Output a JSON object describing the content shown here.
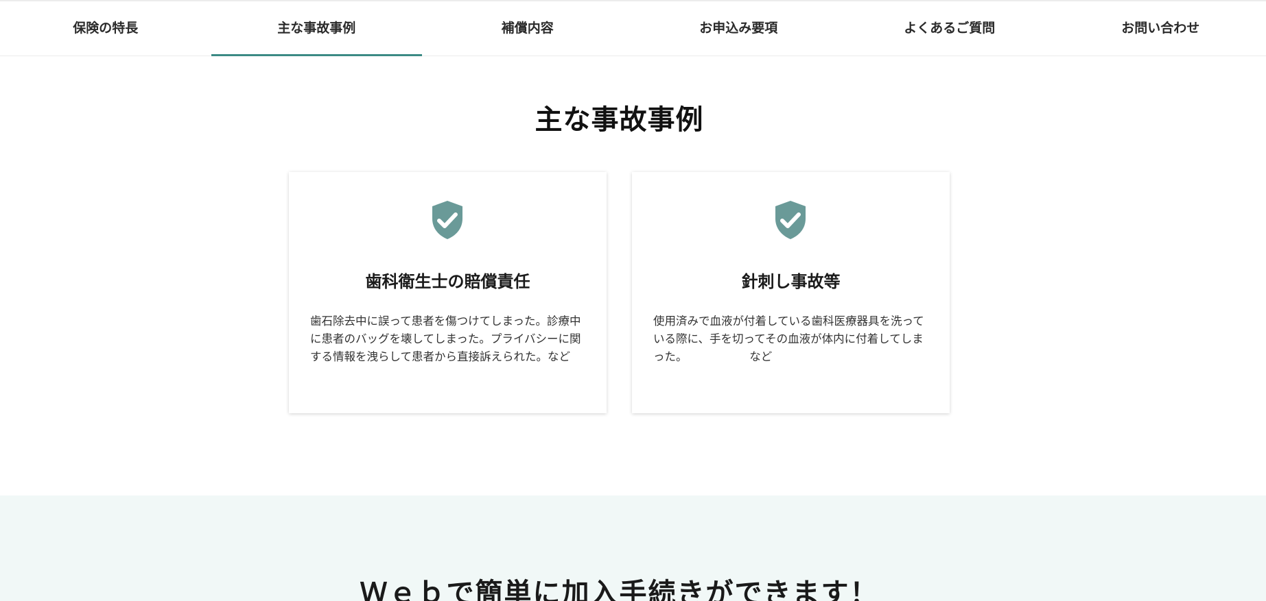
{
  "nav": {
    "items": [
      {
        "label": "保険の特長"
      },
      {
        "label": "主な事故事例"
      },
      {
        "label": "補償内容"
      },
      {
        "label": "お申込み要項"
      },
      {
        "label": "よくあるご質問"
      },
      {
        "label": "お問い合わせ"
      }
    ],
    "active_index": 1
  },
  "section": {
    "title": "主な事故事例"
  },
  "cards": [
    {
      "icon": "shield-check-icon",
      "title": "歯科衛生士の賠償責任",
      "text": "歯石除去中に誤って患者を傷つけてしまった。診療中に患者のバッグを壊してしまった。プライバシーに関する情報を洩らして患者から直接訴えられた。など"
    },
    {
      "icon": "shield-check-icon",
      "title": "針刺し事故等",
      "text": "使用済みで血液が付着している歯科医療器具を洗っている際に、手を切ってその血液が体内に付着してしまった。　　　　　　など"
    }
  ],
  "cta": {
    "title": "Ｗｅｂで簡単に加入手続きができます！"
  },
  "colors": {
    "accent": "#3b8a84",
    "shield": "#6a9a98",
    "cta_background": "#f1f8f7"
  }
}
